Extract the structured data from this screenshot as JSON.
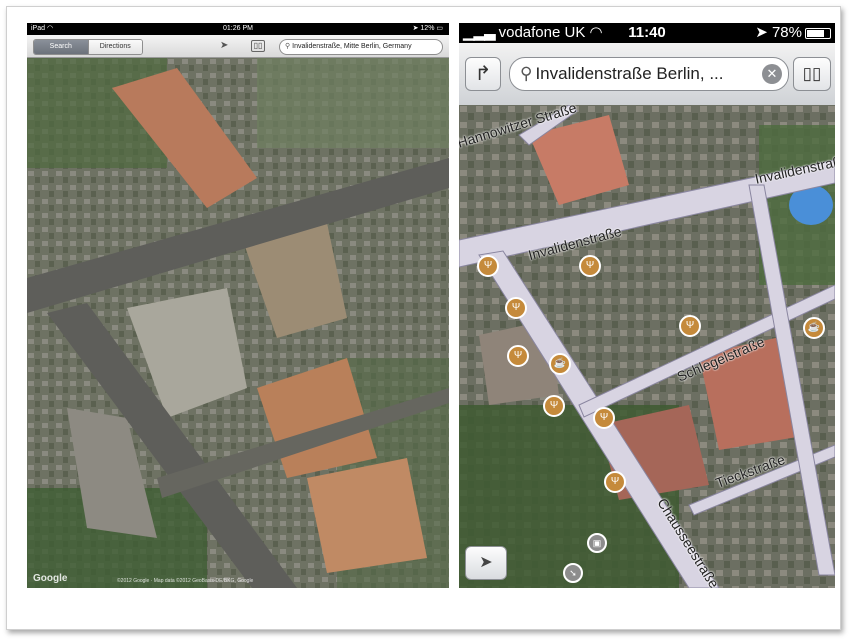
{
  "ipad": {
    "status": {
      "carrier": "iPad",
      "wifi_icon": "wifi-icon",
      "time": "01:26 PM",
      "battery": "12%"
    },
    "toolbar": {
      "segment_search": "Search",
      "segment_directions": "Directions",
      "location_icon": "location-arrow-icon",
      "bookmarks_icon": "book-icon",
      "search_value": "Invalidenstraße, Mitte Berlin, Germany"
    },
    "map": {
      "provider": "Google",
      "copyright": "©2012 Google · Map data ©2012 GeoBasis-DE/BKG, Google"
    }
  },
  "iphone": {
    "status": {
      "carrier": "vodafone UK",
      "time": "11:40",
      "battery": "78%"
    },
    "toolbar": {
      "directions_icon": "turn-arrow-icon",
      "search_value": "Invalidenstraße  Berlin, ...",
      "clear_icon": "clear-icon",
      "bookmarks_icon": "book-icon"
    },
    "map": {
      "streets": [
        "Hannowitzer Straße",
        "Invalidenstraße",
        "Invalidenstraße",
        "Schlegelstraße",
        "Tieckstraße",
        "Chausseestraße"
      ],
      "poi_icon": "restaurant-icon",
      "cafe_icon": "cafe-icon",
      "location_button_icon": "location-arrow-icon"
    }
  }
}
